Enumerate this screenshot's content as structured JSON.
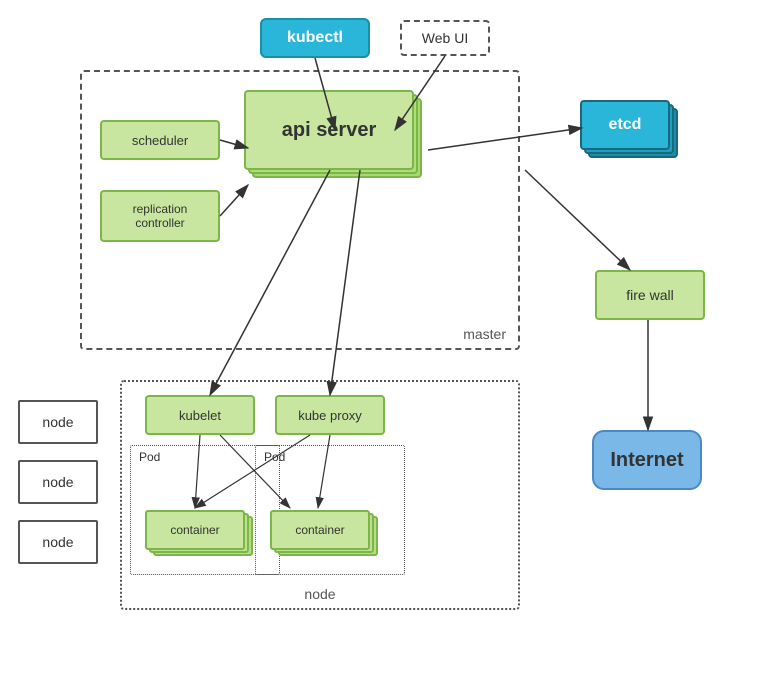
{
  "kubectl": {
    "label": "kubectl"
  },
  "webui": {
    "label": "Web UI"
  },
  "master": {
    "label": "master"
  },
  "scheduler": {
    "label": "scheduler"
  },
  "replication": {
    "label": "replication\ncontroller"
  },
  "apiserver": {
    "label": "api server"
  },
  "etcd": {
    "label": "etcd"
  },
  "firewall": {
    "label": "fire wall"
  },
  "internet": {
    "label": "Internet"
  },
  "nodes": [
    "node",
    "node",
    "node"
  ],
  "node_container": {
    "label": "node"
  },
  "kubelet": {
    "label": "kubelet"
  },
  "kubeproxy": {
    "label": "kube proxy"
  },
  "pod1": {
    "label": "Pod"
  },
  "pod2": {
    "label": "Pod"
  },
  "container1": {
    "label": "container"
  },
  "container2": {
    "label": "container"
  }
}
